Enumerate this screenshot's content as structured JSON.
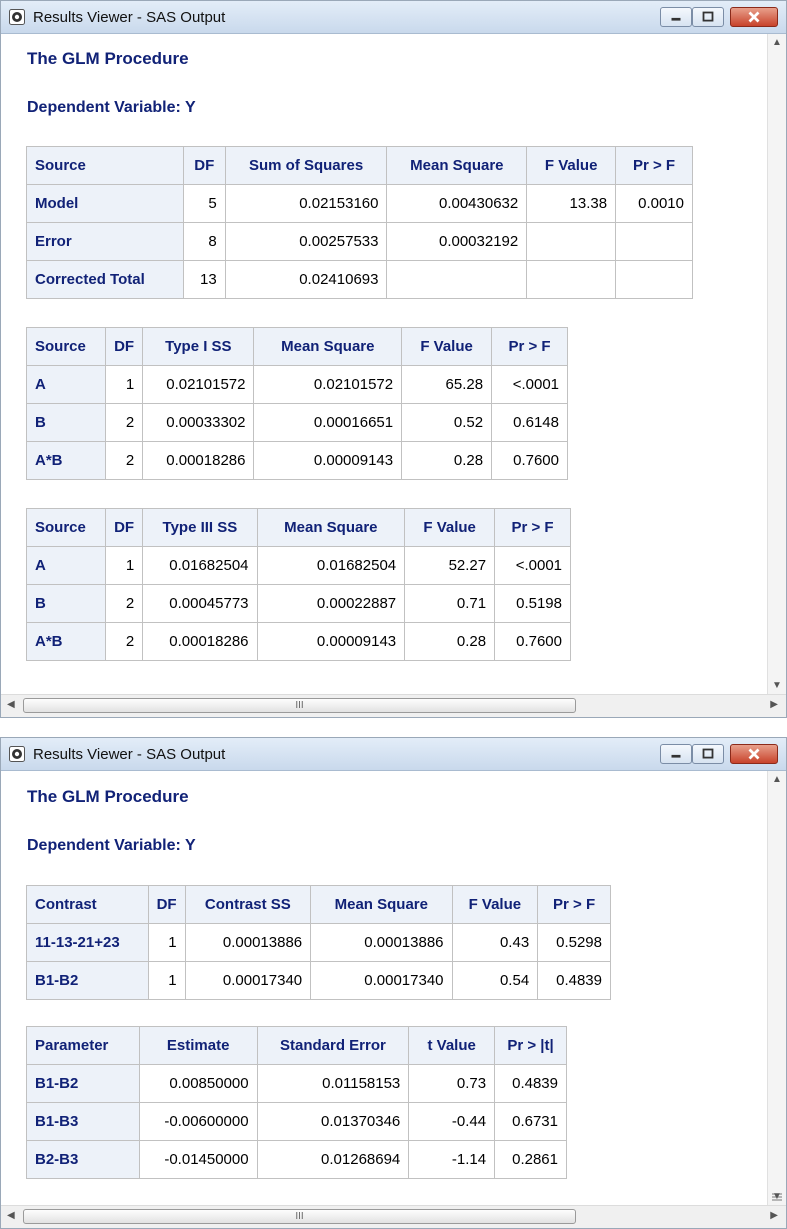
{
  "window1": {
    "title": "Results Viewer - SAS Output",
    "procedure": "The GLM Procedure",
    "dependent": "Dependent Variable: Y",
    "anova": {
      "headers": [
        "Source",
        "DF",
        "Sum of Squares",
        "Mean Square",
        "F Value",
        "Pr > F"
      ],
      "rows": [
        [
          "Model",
          "5",
          "0.02153160",
          "0.00430632",
          "13.38",
          "0.0010"
        ],
        [
          "Error",
          "8",
          "0.00257533",
          "0.00032192",
          "",
          ""
        ],
        [
          "Corrected Total",
          "13",
          "0.02410693",
          "",
          "",
          ""
        ]
      ]
    },
    "type1": {
      "headers": [
        "Source",
        "DF",
        "Type I SS",
        "Mean Square",
        "F Value",
        "Pr > F"
      ],
      "rows": [
        [
          "A",
          "1",
          "0.02101572",
          "0.02101572",
          "65.28",
          "<.0001"
        ],
        [
          "B",
          "2",
          "0.00033302",
          "0.00016651",
          "0.52",
          "0.6148"
        ],
        [
          "A*B",
          "2",
          "0.00018286",
          "0.00009143",
          "0.28",
          "0.7600"
        ]
      ]
    },
    "type3": {
      "headers": [
        "Source",
        "DF",
        "Type III SS",
        "Mean Square",
        "F Value",
        "Pr > F"
      ],
      "rows": [
        [
          "A",
          "1",
          "0.01682504",
          "0.01682504",
          "52.27",
          "<.0001"
        ],
        [
          "B",
          "2",
          "0.00045773",
          "0.00022887",
          "0.71",
          "0.5198"
        ],
        [
          "A*B",
          "2",
          "0.00018286",
          "0.00009143",
          "0.28",
          "0.7600"
        ]
      ]
    },
    "scroll_grip": "III"
  },
  "window2": {
    "title": "Results Viewer - SAS Output",
    "procedure": "The GLM Procedure",
    "dependent": "Dependent Variable: Y",
    "contrast": {
      "headers": [
        "Contrast",
        "DF",
        "Contrast SS",
        "Mean Square",
        "F Value",
        "Pr > F"
      ],
      "rows": [
        [
          "11-13-21+23",
          "1",
          "0.00013886",
          "0.00013886",
          "0.43",
          "0.5298"
        ],
        [
          "B1-B2",
          "1",
          "0.00017340",
          "0.00017340",
          "0.54",
          "0.4839"
        ]
      ]
    },
    "estimate": {
      "headers": [
        "Parameter",
        "Estimate",
        "Standard Error",
        "t Value",
        "Pr > |t|"
      ],
      "rows": [
        [
          "B1-B2",
          "0.00850000",
          "0.01158153",
          "0.73",
          "0.4839"
        ],
        [
          "B1-B3",
          "-0.00600000",
          "0.01370346",
          "-0.44",
          "0.6731"
        ],
        [
          "B2-B3",
          "-0.01450000",
          "0.01268694",
          "-1.14",
          "0.2861"
        ]
      ]
    },
    "scroll_grip": "III"
  },
  "colors": {
    "header_text": "#112277",
    "header_bg": "#edf2f9",
    "border": "#c1c1c1",
    "close_button": "#c8432b"
  }
}
